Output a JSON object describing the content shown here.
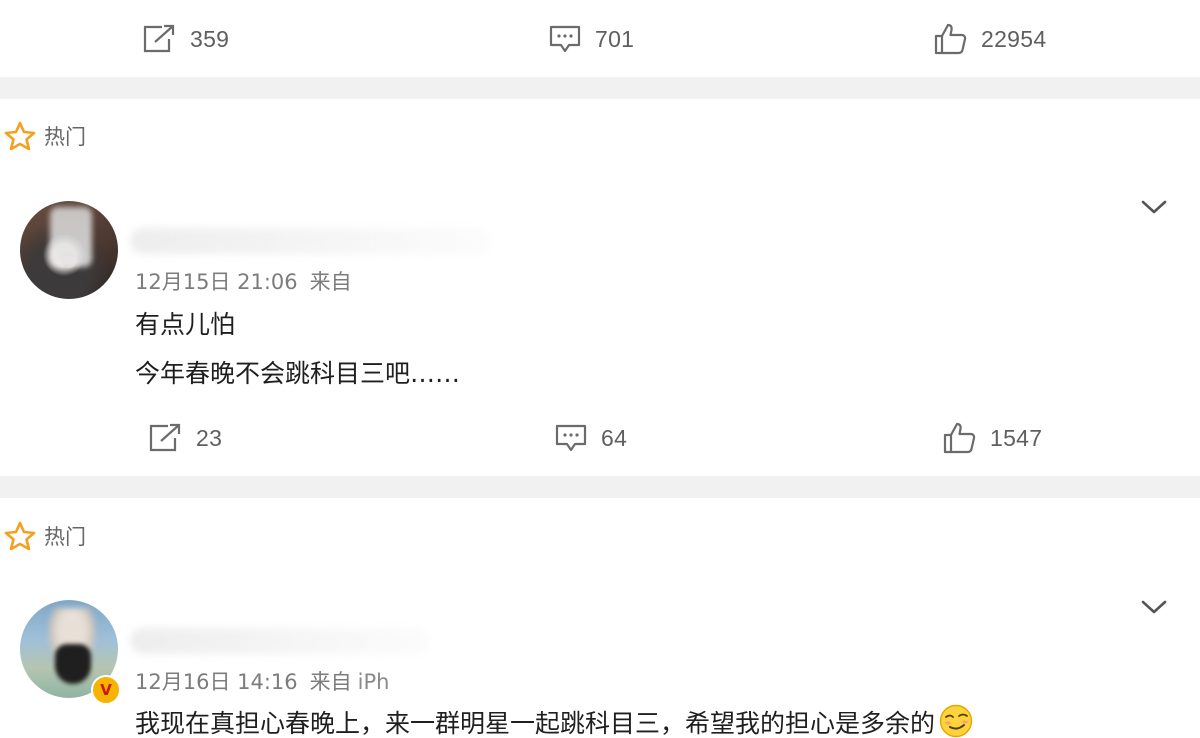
{
  "post_actions": {
    "repost_count": "359",
    "comment_count": "701",
    "like_count": "22954"
  },
  "comments": [
    {
      "badge_label": "热门",
      "date": "12月15日 21:06",
      "source_prefix": "来自",
      "device": "",
      "lines": [
        "有点儿怕",
        "今年春晚不会跳科目三吧……"
      ],
      "actions": {
        "repost_count": "23",
        "comment_count": "64",
        "like_count": "1547"
      }
    },
    {
      "badge_label": "热门",
      "date": "12月16日 14:16",
      "source_prefix": "来自",
      "device": "iPh",
      "verified_badge": "V",
      "lines": [
        "我现在真担心春晚上，来一群明星一起跳科目三，希望我的担心是多余的"
      ],
      "emoji": "smirk-emoji"
    }
  ],
  "colors": {
    "star": "#f4a01e",
    "separator": "#f1f1f1",
    "meta_text": "#7c7c7c",
    "icon_stroke": "#6b6b6b",
    "verified": "#f6b400"
  },
  "icons": [
    "repost-icon",
    "comment-icon",
    "like-icon",
    "star-icon",
    "chevron-down-icon",
    "verified-badge-icon",
    "smirk-emoji"
  ]
}
